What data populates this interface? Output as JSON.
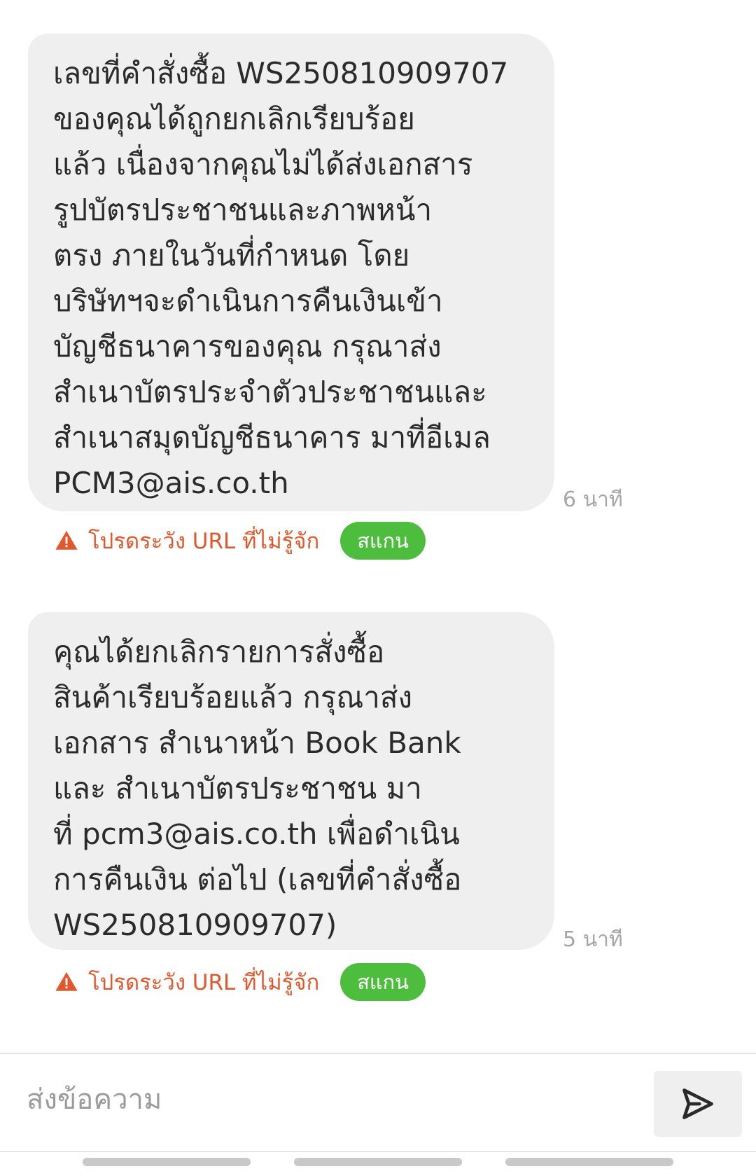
{
  "messages": [
    {
      "text": "เลขที่คำสั่งซื้อ WS250810909707\nของคุณได้ถูกยกเลิกเรียบร้อย\nแล้ว เนื่องจากคุณไม่ได้ส่งเอกสาร\nรูปบัตรประชาชนและภาพหน้า\nตรง ภายในวันที่กำหนด โดย\nบริษัทฯจะดำเนินการคืนเงินเข้า\nบัญชีธนาคารของคุณ กรุณาส่ง\nสำเนาบัตรประจำตัวประชาชนและ\nสำเนาสมุดบัญชีธนาคาร มาที่อีเมล\nPCM3@ais.co.th",
      "time": "6 นาที",
      "warning": "โปรดระวัง URL ที่ไม่รู้จัก",
      "scan_label": "สแกน"
    },
    {
      "text": "คุณได้ยกเลิกรายการสั่งซื้อ\nสินค้าเรียบร้อยแล้ว กรุณาส่ง\nเอกสาร สำเนาหน้า Book Bank\nและ สำเนาบัตรประชาชน มา\nที่ pcm3@ais.co.th  เพื่อดำเนิน\nการคืนเงิน ต่อไป  (เลขที่คำสั่งซื้อ\nWS250810909707)",
      "time": "5 นาที",
      "warning": "โปรดระวัง URL ที่ไม่รู้จัก",
      "scan_label": "สแกน"
    }
  ],
  "composer": {
    "placeholder": "ส่งข้อความ"
  },
  "colors": {
    "bubble": "#efefef",
    "warning": "#e0582c",
    "scan_button": "#4cbd3c",
    "timestamp": "#a6a6a6"
  },
  "icons": {
    "warning": "warning-triangle-icon",
    "send": "send-arrow-icon"
  }
}
